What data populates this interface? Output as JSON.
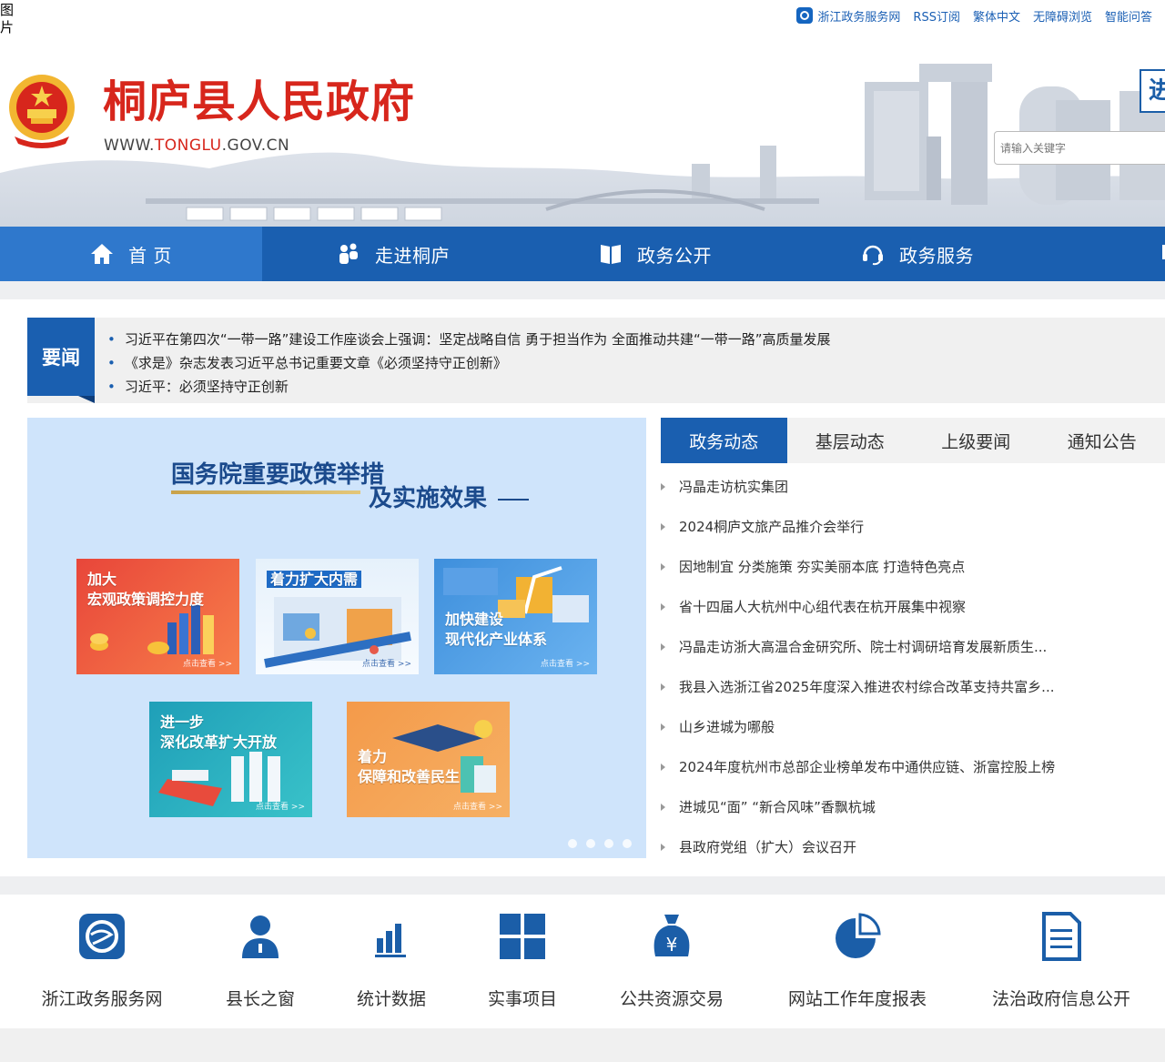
{
  "broken_image_alt": "图片",
  "topbar": {
    "links": [
      "浙江政务服务网",
      "RSS订阅",
      "繁体中文",
      "无障碍浏览",
      "智能问答"
    ]
  },
  "header": {
    "title": "桐庐县人民政府",
    "url_prefix": "WWW.",
    "url_highlight": "TONGLU",
    "url_suffix": ".GOV.CN",
    "search_placeholder": "请输入关键字",
    "enter_label": "进"
  },
  "nav": {
    "items": [
      {
        "label": "首 页",
        "icon": "home-icon"
      },
      {
        "label": "走进桐庐",
        "icon": "people-icon"
      },
      {
        "label": "政务公开",
        "icon": "book-icon"
      },
      {
        "label": "政务服务",
        "icon": "headset-icon"
      },
      {
        "label": "",
        "icon": "message-icon"
      }
    ]
  },
  "headlines": {
    "tag": "要闻",
    "items": [
      "习近平在第四次“一带一路”建设工作座谈会上强调：坚定战略自信 勇于担当作为 全面推动共建“一带一路”高质量发展",
      "《求是》杂志发表习近平总书记重要文章《必须坚持守正创新》",
      "习近平：必须坚持守正创新"
    ]
  },
  "carousel": {
    "title_line1": "国务院重要政策举措",
    "title_line2": "及实施效果",
    "tiles": [
      {
        "line1": "加大",
        "line2": "宏观政策调控力度",
        "more": "点击查看 >>"
      },
      {
        "line1": "着力扩大内需",
        "line2": "",
        "more": "点击查看 >>"
      },
      {
        "line1": "加快建设",
        "line2": "现代化产业体系",
        "more": "点击查看 >>"
      },
      {
        "line1": "进一步",
        "line2": "深化改革扩大开放",
        "more": "点击查看 >>"
      },
      {
        "line1": "着力",
        "line2": "保障和改善民生",
        "more": "点击查看 >>"
      }
    ]
  },
  "news": {
    "tabs": [
      "政务动态",
      "基层动态",
      "上级要闻",
      "通知公告"
    ],
    "items": [
      "冯晶走访杭实集团",
      "2024桐庐文旅产品推介会举行",
      "因地制宜 分类施策 夯实美丽本底 打造特色亮点",
      "省十四届人大杭州中心组代表在杭开展集中视察",
      "冯晶走访浙大高温合金研究所、院士村调研培育发展新质生...",
      "我县入选浙江省2025年度深入推进农村综合改革支持共富乡...",
      "山乡进城为哪般",
      "2024年度杭州市总部企业榜单发布中通供应链、浙富控股上榜",
      "进城见“面” “新合风味”香飘杭城",
      "县政府党组（扩大）会议召开"
    ]
  },
  "quick_links": [
    {
      "label": "浙江政务服务网",
      "icon": "zhejiang-service-icon"
    },
    {
      "label": "县长之窗",
      "icon": "person-icon"
    },
    {
      "label": "统计数据",
      "icon": "bar-chart-icon"
    },
    {
      "label": "实事项目",
      "icon": "grid-icon"
    },
    {
      "label": "公共资源交易",
      "icon": "money-bag-icon"
    },
    {
      "label": "网站工作年度报表",
      "icon": "pie-chart-icon"
    },
    {
      "label": "法治政府信息公开",
      "icon": "document-icon"
    }
  ],
  "colors": {
    "brand_blue": "#1a5fb0",
    "title_red": "#d7261c",
    "carousel_bg": "#cfe4fb"
  }
}
